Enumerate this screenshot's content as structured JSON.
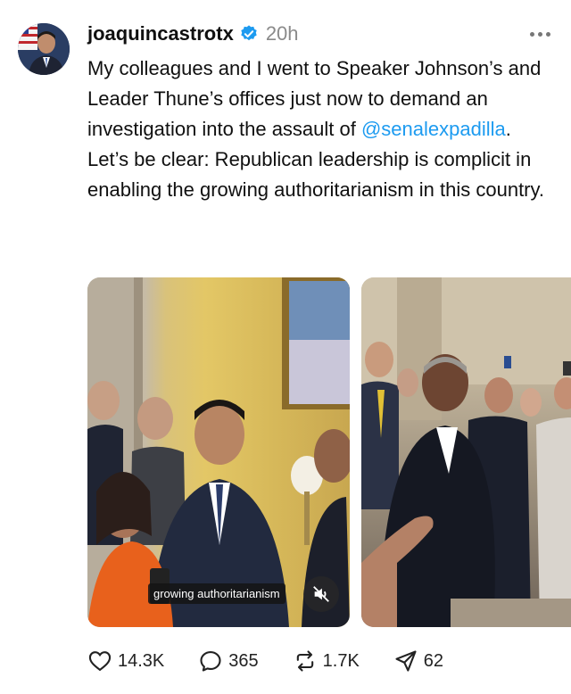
{
  "post": {
    "username": "joaquincastrotx",
    "time": "20h",
    "text_before": "My colleagues and I went to Speaker Johnson’s and Leader Thune’s offices just now to demand an investigation into the assault of ",
    "mention": "@senalexpadilla",
    "text_after": ". Let’s be clear: Republican leadership is complicit in enabling the growing authoritarianism in this country."
  },
  "media": {
    "video_caption": "growing authoritarianism"
  },
  "actions": {
    "likes": "14.3K",
    "replies": "365",
    "reposts": "1.7K",
    "shares": "62"
  },
  "colors": {
    "accent": "#1d9bf0",
    "text": "#101010",
    "muted": "#8a8a8a"
  },
  "icons": [
    "verified-icon",
    "more-icon",
    "mute-icon",
    "heart-icon",
    "reply-icon",
    "repost-icon",
    "share-icon"
  ]
}
